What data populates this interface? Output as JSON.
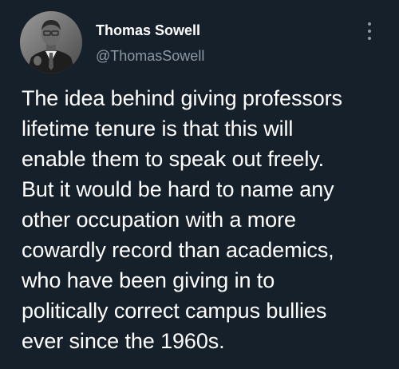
{
  "tweet": {
    "author": {
      "display_name": "Thomas Sowell",
      "handle": "@ThomasSowell",
      "avatar_icon": "profile-photo"
    },
    "more_icon": "more-options-icon",
    "text": "The idea behind giving professors\nlifetime tenure is that this will\nenable them to speak out freely.\nBut it would be hard to name any\nother occupation with a more\ncowardly record than academics,\nwho have been giving in to\npolitically correct campus bullies\never since the 1960s."
  },
  "colors": {
    "background": "#15202b",
    "primary_text": "#ffffff",
    "secondary_text": "#8b98a5"
  }
}
